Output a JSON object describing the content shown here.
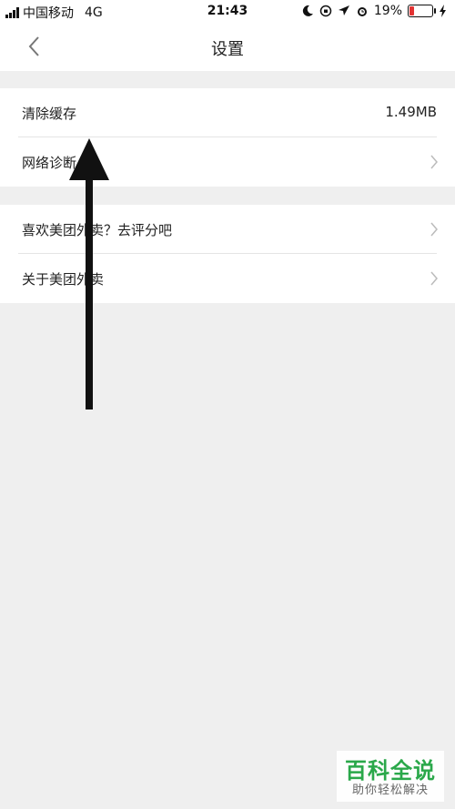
{
  "status_bar": {
    "carrier": "中国移动",
    "network": "4G",
    "time": "21:43",
    "battery_percent": "19%",
    "battery_level": 0.19,
    "battery_color": "#e33333"
  },
  "nav": {
    "title": "设置",
    "back_icon": "chevron-left-icon"
  },
  "groups": [
    {
      "rows": [
        {
          "label": "清除缓存",
          "value": "1.49MB"
        },
        {
          "label": "网络诊断",
          "chevron": true
        }
      ]
    },
    {
      "rows": [
        {
          "label": "喜欢美团外卖？去评分吧",
          "chevron": true
        },
        {
          "label": "关于美团外卖",
          "chevron": true
        }
      ]
    }
  ],
  "annotation": {
    "icon": "up-arrow-icon",
    "color": "#111111"
  },
  "watermark": {
    "title": "百科全说",
    "subtitle": "助你轻松解决",
    "color": "#2aa84a"
  }
}
